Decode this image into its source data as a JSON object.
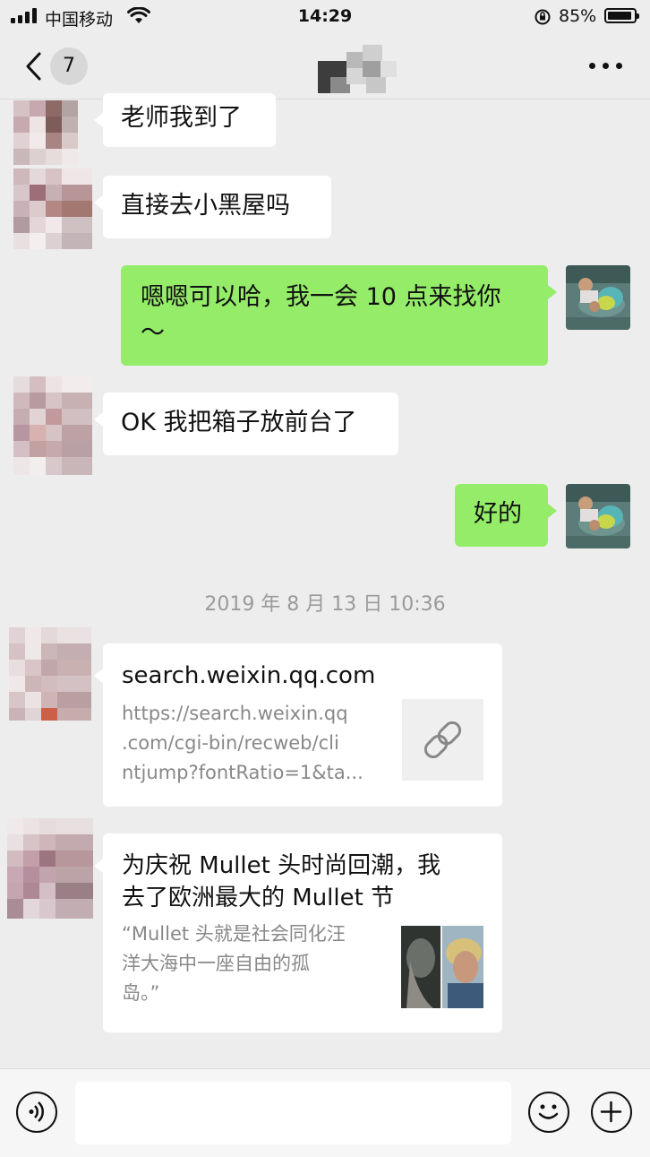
{
  "status_bar": {
    "carrier": "中国移动",
    "time": "14:29",
    "battery": "85%"
  },
  "nav": {
    "unread_count": "7"
  },
  "messages": [
    {
      "side": "left",
      "text": "老师我到了"
    },
    {
      "side": "left",
      "text": "直接去小黑屋吗"
    },
    {
      "side": "right",
      "line1": "嗯嗯可以哈，我一会 10 点来找你",
      "line2": "～"
    },
    {
      "side": "left",
      "text": "OK 我把箱子放前台了"
    },
    {
      "side": "right",
      "text": "好的"
    }
  ],
  "timestamp": "2019 年 8 月 13 日 10:36",
  "link_card": {
    "title": "search.weixin.qq.com",
    "desc_lines": [
      "https://search.weixin.qq",
      ".com/cgi-bin/recweb/cli",
      "ntjump?fontRatio=1&ta..."
    ],
    "icon": "link-icon"
  },
  "article_card": {
    "title_lines": [
      "为庆祝 Mullet 头时尚回潮，我",
      "去了欧洲最大的 Mullet 节"
    ],
    "desc_lines": [
      "“Mullet 头就是社会同化汪",
      "洋大海中一座自由的孤",
      "岛。”"
    ]
  },
  "colors": {
    "background": "#ededed",
    "sent_bubble": "#95ec69",
    "received_bubble": "#ffffff",
    "timestamp_text": "#9a9a9a"
  },
  "icons": [
    "signal-icon",
    "wifi-icon",
    "rotation-lock-icon",
    "battery-icon",
    "back-chevron-icon",
    "more-icon",
    "voice-icon",
    "emoji-icon",
    "plus-icon"
  ]
}
